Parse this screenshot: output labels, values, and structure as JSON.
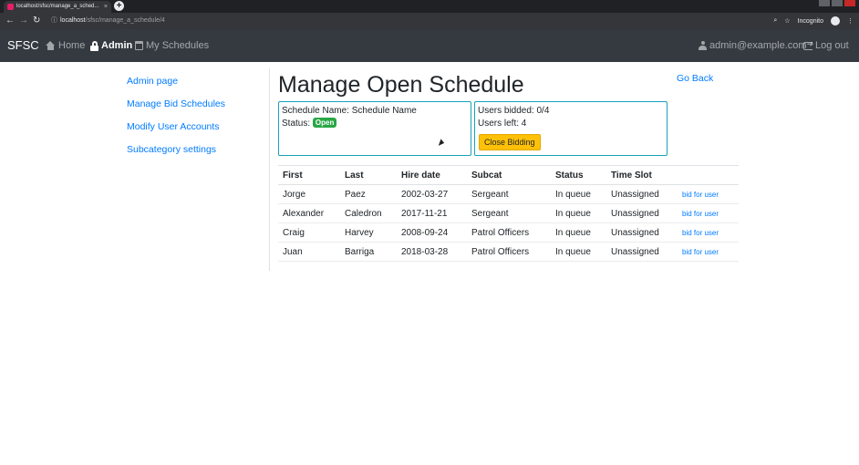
{
  "browser": {
    "tab_title": "localhost/sfsc/manage_a_sched...",
    "tab_close": "×",
    "new_tab": "+",
    "url_host": "localhost",
    "url_path": "/sfsc/manage_a_schedule/4",
    "incognito_label": "Incognito"
  },
  "navbar": {
    "brand": "SFSC",
    "home": "Home",
    "admin": "Admin",
    "my_schedules": "My Schedules",
    "user": "admin@example.com",
    "logout": "Log out"
  },
  "sidebar": {
    "items": [
      {
        "label": "Admin page"
      },
      {
        "label": "Manage Bid Schedules"
      },
      {
        "label": "Modify User Accounts"
      },
      {
        "label": "Subcategory settings"
      }
    ]
  },
  "main": {
    "title": "Manage Open Schedule",
    "go_back": "Go Back",
    "schedule_name_label": "Schedule Name:",
    "schedule_name_value": "Schedule Name",
    "status_label": "Status:",
    "status_badge": "Open",
    "users_bidded": "Users bidded: 0/4",
    "users_left": "Users left: 4",
    "close_bidding": "Close Bidding"
  },
  "table": {
    "headers": [
      "First",
      "Last",
      "Hire date",
      "Subcat",
      "Status",
      "Time Slot",
      ""
    ],
    "rows": [
      {
        "first": "Jorge",
        "last": "Paez",
        "hire": "2002-03-27",
        "subcat": "Sergeant",
        "status": "In queue",
        "slot": "Unassigned",
        "action": "bid for user"
      },
      {
        "first": "Alexander",
        "last": "Caledron",
        "hire": "2017-11-21",
        "subcat": "Sergeant",
        "status": "In queue",
        "slot": "Unassigned",
        "action": "bid for user"
      },
      {
        "first": "Craig",
        "last": "Harvey",
        "hire": "2008-09-24",
        "subcat": "Patrol Officers",
        "status": "In queue",
        "slot": "Unassigned",
        "action": "bid for user"
      },
      {
        "first": "Juan",
        "last": "Barriga",
        "hire": "2018-03-28",
        "subcat": "Patrol Officers",
        "status": "In queue",
        "slot": "Unassigned",
        "action": "bid for user"
      }
    ]
  },
  "colors": {
    "navbar_bg": "#343a40",
    "link": "#007bff",
    "box_border": "#17a2b8",
    "badge_green": "#28a745",
    "warning": "#ffc107"
  }
}
